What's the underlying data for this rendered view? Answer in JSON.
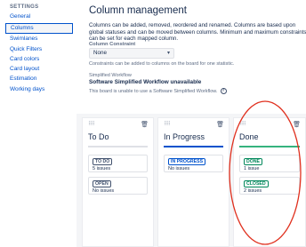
{
  "sidebar": {
    "heading": "SETTINGS",
    "items": [
      {
        "label": "General"
      },
      {
        "label": "Columns"
      },
      {
        "label": "Swimlanes"
      },
      {
        "label": "Quick Filters"
      },
      {
        "label": "Card colors"
      },
      {
        "label": "Card layout"
      },
      {
        "label": "Estimation"
      },
      {
        "label": "Working days"
      }
    ],
    "active_index": 1
  },
  "main": {
    "title": "Column management",
    "description": "Columns can be added, removed, reordered and renamed. Columns are based upon global statuses and can be moved between columns. Minimum and maximum constraints can be set for each mapped column.",
    "constraint_label": "Column Constraint",
    "constraint_value": "None",
    "constraint_hint": "Constraints can be added to columns on the board for one statistic.",
    "simplified_label": "Simplified Workflow",
    "simplified_title": "Software Simplified Workflow unavailable",
    "simplified_note": "This board is unable to use a Software Simplified Workflow."
  },
  "columns": [
    {
      "name": "To Do",
      "bar_color": "#dfe1e6",
      "statuses": [
        {
          "label": "TO DO",
          "count": "5 issues",
          "color": "#42526e"
        },
        {
          "label": "OPEN",
          "count": "No issues",
          "color": "#42526e"
        }
      ]
    },
    {
      "name": "In Progress",
      "bar_color": "#0052cc",
      "statuses": [
        {
          "label": "IN PROGRESS",
          "count": "No issues",
          "color": "#0052cc"
        }
      ]
    },
    {
      "name": "Done",
      "bar_color": "#36b37e",
      "statuses": [
        {
          "label": "DONE",
          "count": "1 issue",
          "color": "#00875a"
        },
        {
          "label": "CLOSED",
          "count": "2 issues",
          "color": "#00875a"
        }
      ]
    }
  ],
  "colors": {
    "highlight_oval": "#e0301e"
  }
}
